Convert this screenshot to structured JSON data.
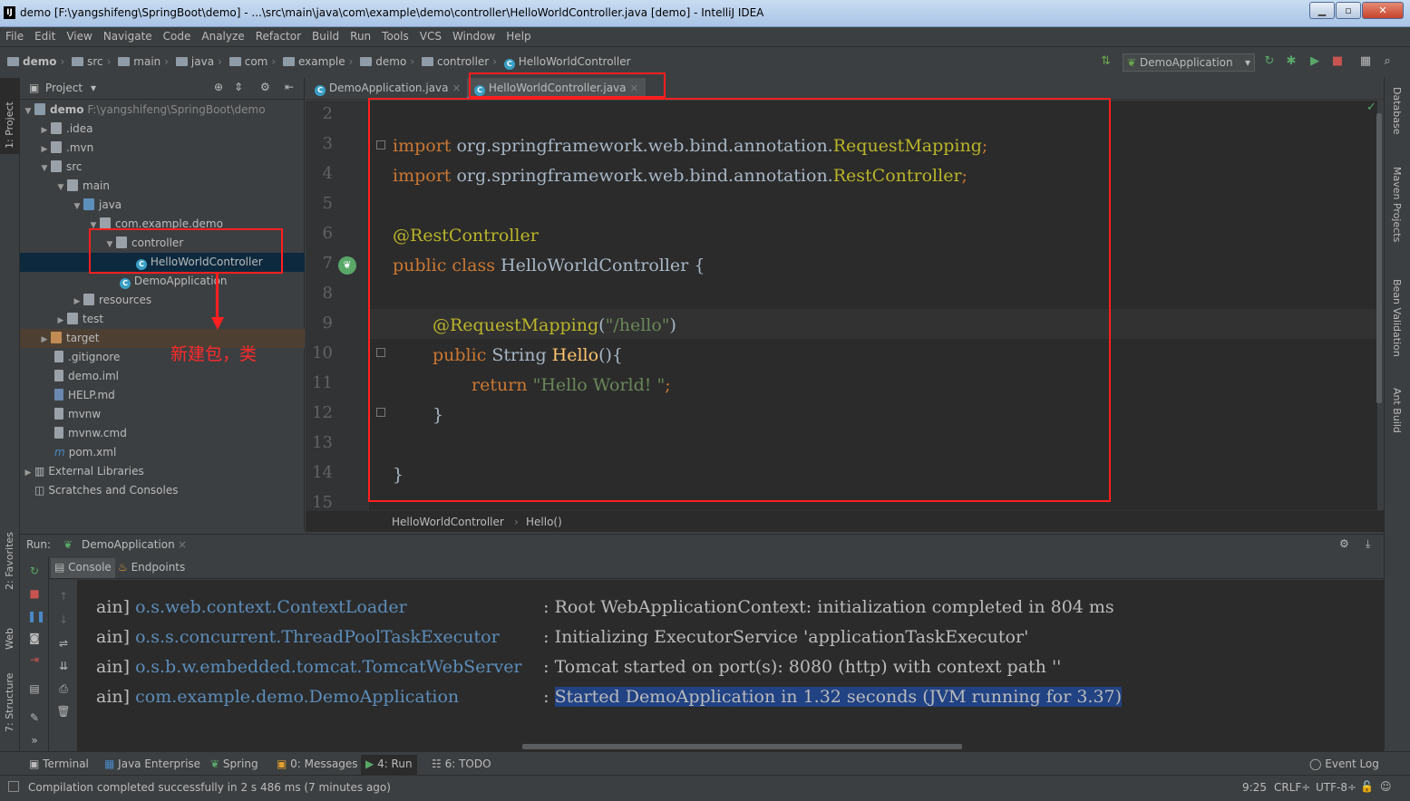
{
  "window": {
    "title": "demo [F:\\yangshifeng\\SpringBoot\\demo] - ...\\src\\main\\java\\com\\example\\demo\\controller\\HelloWorldController.java [demo] - IntelliJ IDEA",
    "logo": "IJ"
  },
  "menu": [
    "File",
    "Edit",
    "View",
    "Navigate",
    "Code",
    "Analyze",
    "Refactor",
    "Build",
    "Run",
    "Tools",
    "VCS",
    "Window",
    "Help"
  ],
  "breadcrumbs": [
    "demo",
    "src",
    "main",
    "java",
    "com",
    "example",
    "demo",
    "controller",
    "HelloWorldController"
  ],
  "run_config": "DemoApplication",
  "project": {
    "header": "Project",
    "root_name": "demo",
    "root_path": "F:\\yangshifeng\\SpringBoot\\demo",
    "idea": ".idea",
    "mvn": ".mvn",
    "src": "src",
    "main": "main",
    "java": "java",
    "pkg": "com.example.demo",
    "controller": "controller",
    "hwc": "HelloWorldController",
    "demoapp": "DemoApplication",
    "resources": "resources",
    "test": "test",
    "target": "target",
    "gitignore": ".gitignore",
    "demoiml": "demo.iml",
    "help": "HELP.md",
    "mvnw": "mvnw",
    "mvnwcmd": "mvnw.cmd",
    "pom": "pom.xml",
    "extlib": "External Libraries",
    "scratches": "Scratches and Consoles"
  },
  "annotation": "新建包，类",
  "editor": {
    "tabs": [
      "DemoApplication.java",
      "HelloWorldController.java"
    ],
    "active_tab": 1,
    "line_numbers": [
      "2",
      "3",
      "4",
      "5",
      "6",
      "7",
      "8",
      "9",
      "10",
      "11",
      "12",
      "13",
      "14",
      "15"
    ],
    "import_kw": "import",
    "pkg_path": "org.springframework.web.bind.annotation.",
    "req_mapping": "RequestMapping",
    "rest_ctrl": "RestController",
    "anno_rest": "@RestController",
    "public_kw": "public",
    "class_kw": "class",
    "class_name": "HelloWorldController",
    "brace_open": "{",
    "anno_req": "@RequestMapping",
    "route": "\"/hello\"",
    "string_kw": "String",
    "method": "Hello",
    "parens": "()",
    "return_kw": "return",
    "ret_val": "\"Hello World! \"",
    "semi": ";",
    "brace_close": "}",
    "paren_open": "(",
    "paren_close": ")"
  },
  "breadcrumb_bottom": [
    "HelloWorldController",
    "Hello()"
  ],
  "run": {
    "label": "Run:",
    "config": "DemoApplication",
    "tabs": [
      "Console",
      "Endpoints"
    ]
  },
  "console": [
    {
      "prefix": "ain]",
      "cls": "o.s.web.context.ContextLoader",
      "sep": ":",
      "msg": "Root WebApplicationContext: initialization completed in 804 ms"
    },
    {
      "prefix": "ain]",
      "cls": "o.s.s.concurrent.ThreadPoolTaskExecutor",
      "sep": ":",
      "msg": "Initializing ExecutorService 'applicationTaskExecutor'"
    },
    {
      "prefix": "ain]",
      "cls": "o.s.b.w.embedded.tomcat.TomcatWebServer",
      "sep": ":",
      "msg": "Tomcat started on port(s): 8080 (http) with context path ''"
    },
    {
      "prefix": "ain]",
      "cls": "com.example.demo.DemoApplication",
      "sep": ":",
      "msg": "Started DemoApplication in 1.32 seconds (JVM running for 3.37)"
    }
  ],
  "toolwindows": [
    "Terminal",
    "Java Enterprise",
    "Spring",
    "0: Messages",
    "4: Run",
    "6: TODO"
  ],
  "event_log": "Event Log",
  "status": {
    "message": "Compilation completed successfully in 2 s 486 ms (7 minutes ago)",
    "position": "9:25",
    "line_sep": "CRLF÷",
    "encoding": "UTF-8÷"
  },
  "left_strip": [
    "1: Project",
    "2: Favorites",
    "Web",
    "7: Structure"
  ],
  "right_strip": [
    "Database",
    "Maven Projects",
    "Bean Validation",
    "Ant Build"
  ]
}
